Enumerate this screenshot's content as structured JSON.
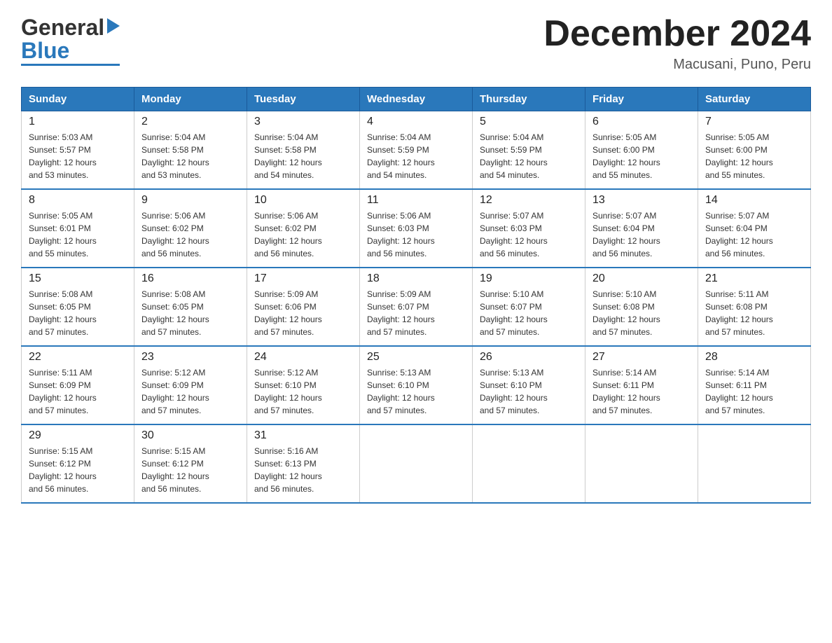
{
  "header": {
    "logo": {
      "line1": "General",
      "line2": "Blue"
    },
    "title": "December 2024",
    "location": "Macusani, Puno, Peru"
  },
  "calendar": {
    "days_of_week": [
      "Sunday",
      "Monday",
      "Tuesday",
      "Wednesday",
      "Thursday",
      "Friday",
      "Saturday"
    ],
    "weeks": [
      [
        {
          "day": "1",
          "sunrise": "5:03 AM",
          "sunset": "5:57 PM",
          "daylight": "12 hours and 53 minutes."
        },
        {
          "day": "2",
          "sunrise": "5:04 AM",
          "sunset": "5:58 PM",
          "daylight": "12 hours and 53 minutes."
        },
        {
          "day": "3",
          "sunrise": "5:04 AM",
          "sunset": "5:58 PM",
          "daylight": "12 hours and 54 minutes."
        },
        {
          "day": "4",
          "sunrise": "5:04 AM",
          "sunset": "5:59 PM",
          "daylight": "12 hours and 54 minutes."
        },
        {
          "day": "5",
          "sunrise": "5:04 AM",
          "sunset": "5:59 PM",
          "daylight": "12 hours and 54 minutes."
        },
        {
          "day": "6",
          "sunrise": "5:05 AM",
          "sunset": "6:00 PM",
          "daylight": "12 hours and 55 minutes."
        },
        {
          "day": "7",
          "sunrise": "5:05 AM",
          "sunset": "6:00 PM",
          "daylight": "12 hours and 55 minutes."
        }
      ],
      [
        {
          "day": "8",
          "sunrise": "5:05 AM",
          "sunset": "6:01 PM",
          "daylight": "12 hours and 55 minutes."
        },
        {
          "day": "9",
          "sunrise": "5:06 AM",
          "sunset": "6:02 PM",
          "daylight": "12 hours and 56 minutes."
        },
        {
          "day": "10",
          "sunrise": "5:06 AM",
          "sunset": "6:02 PM",
          "daylight": "12 hours and 56 minutes."
        },
        {
          "day": "11",
          "sunrise": "5:06 AM",
          "sunset": "6:03 PM",
          "daylight": "12 hours and 56 minutes."
        },
        {
          "day": "12",
          "sunrise": "5:07 AM",
          "sunset": "6:03 PM",
          "daylight": "12 hours and 56 minutes."
        },
        {
          "day": "13",
          "sunrise": "5:07 AM",
          "sunset": "6:04 PM",
          "daylight": "12 hours and 56 minutes."
        },
        {
          "day": "14",
          "sunrise": "5:07 AM",
          "sunset": "6:04 PM",
          "daylight": "12 hours and 56 minutes."
        }
      ],
      [
        {
          "day": "15",
          "sunrise": "5:08 AM",
          "sunset": "6:05 PM",
          "daylight": "12 hours and 57 minutes."
        },
        {
          "day": "16",
          "sunrise": "5:08 AM",
          "sunset": "6:05 PM",
          "daylight": "12 hours and 57 minutes."
        },
        {
          "day": "17",
          "sunrise": "5:09 AM",
          "sunset": "6:06 PM",
          "daylight": "12 hours and 57 minutes."
        },
        {
          "day": "18",
          "sunrise": "5:09 AM",
          "sunset": "6:07 PM",
          "daylight": "12 hours and 57 minutes."
        },
        {
          "day": "19",
          "sunrise": "5:10 AM",
          "sunset": "6:07 PM",
          "daylight": "12 hours and 57 minutes."
        },
        {
          "day": "20",
          "sunrise": "5:10 AM",
          "sunset": "6:08 PM",
          "daylight": "12 hours and 57 minutes."
        },
        {
          "day": "21",
          "sunrise": "5:11 AM",
          "sunset": "6:08 PM",
          "daylight": "12 hours and 57 minutes."
        }
      ],
      [
        {
          "day": "22",
          "sunrise": "5:11 AM",
          "sunset": "6:09 PM",
          "daylight": "12 hours and 57 minutes."
        },
        {
          "day": "23",
          "sunrise": "5:12 AM",
          "sunset": "6:09 PM",
          "daylight": "12 hours and 57 minutes."
        },
        {
          "day": "24",
          "sunrise": "5:12 AM",
          "sunset": "6:10 PM",
          "daylight": "12 hours and 57 minutes."
        },
        {
          "day": "25",
          "sunrise": "5:13 AM",
          "sunset": "6:10 PM",
          "daylight": "12 hours and 57 minutes."
        },
        {
          "day": "26",
          "sunrise": "5:13 AM",
          "sunset": "6:10 PM",
          "daylight": "12 hours and 57 minutes."
        },
        {
          "day": "27",
          "sunrise": "5:14 AM",
          "sunset": "6:11 PM",
          "daylight": "12 hours and 57 minutes."
        },
        {
          "day": "28",
          "sunrise": "5:14 AM",
          "sunset": "6:11 PM",
          "daylight": "12 hours and 57 minutes."
        }
      ],
      [
        {
          "day": "29",
          "sunrise": "5:15 AM",
          "sunset": "6:12 PM",
          "daylight": "12 hours and 56 minutes."
        },
        {
          "day": "30",
          "sunrise": "5:15 AM",
          "sunset": "6:12 PM",
          "daylight": "12 hours and 56 minutes."
        },
        {
          "day": "31",
          "sunrise": "5:16 AM",
          "sunset": "6:13 PM",
          "daylight": "12 hours and 56 minutes."
        },
        null,
        null,
        null,
        null
      ]
    ],
    "labels": {
      "sunrise": "Sunrise:",
      "sunset": "Sunset:",
      "daylight": "Daylight:"
    }
  }
}
